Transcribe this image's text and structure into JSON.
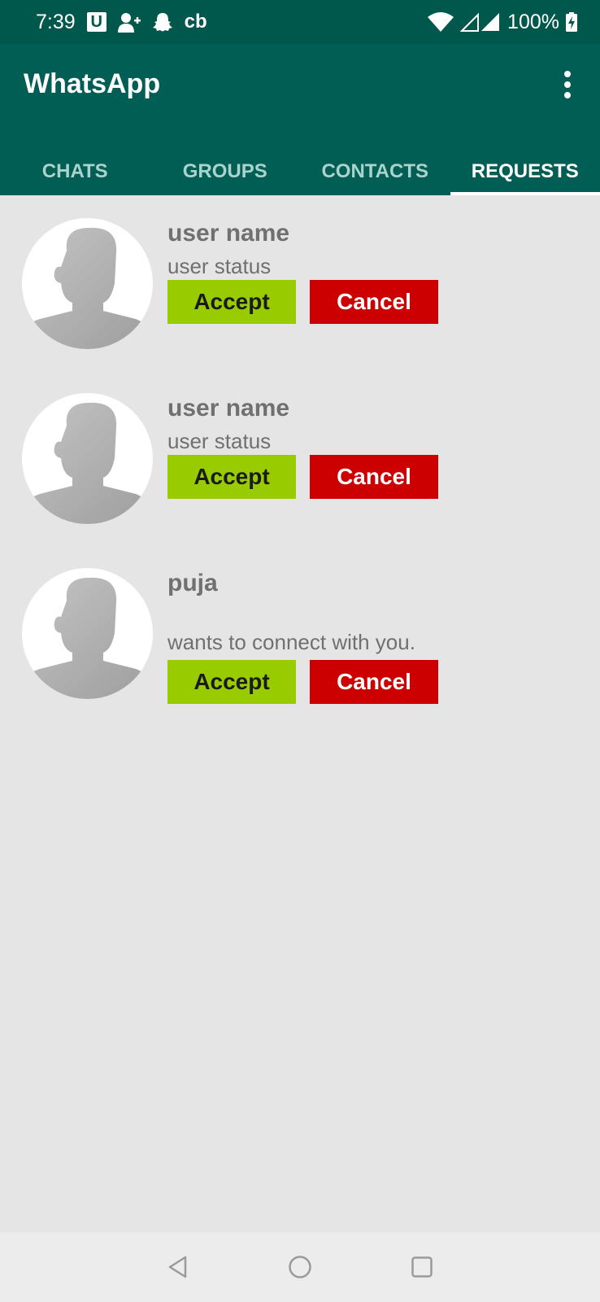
{
  "status_bar": {
    "time": "7:39",
    "u_icon_label": "U",
    "cb_label": "cb",
    "battery": "100%",
    "icons": [
      "u-icon",
      "add-user-icon",
      "snapchat-icon",
      "wifi-icon",
      "signal-icon",
      "battery-icon"
    ]
  },
  "app_bar": {
    "title": "WhatsApp",
    "menu_icon": "more-vert-icon"
  },
  "tabs": [
    {
      "label": "CHATS",
      "active": false
    },
    {
      "label": "GROUPS",
      "active": false
    },
    {
      "label": "CONTACTS",
      "active": false
    },
    {
      "label": "REQUESTS",
      "active": true
    }
  ],
  "requests": [
    {
      "name": "user name",
      "status": "user status",
      "accept_label": "Accept",
      "cancel_label": "Cancel"
    },
    {
      "name": "user name",
      "status": "user status",
      "accept_label": "Accept",
      "cancel_label": "Cancel"
    },
    {
      "name": "puja",
      "status": "wants to connect with you.",
      "accept_label": "Accept",
      "cancel_label": "Cancel"
    }
  ],
  "nav_bar": {
    "icons": [
      "back-icon",
      "home-icon",
      "recents-icon"
    ]
  },
  "colors": {
    "status_bar": "#00574b",
    "app_bar": "#005e54",
    "accept": "#99cc00",
    "cancel": "#cc0000",
    "background": "#e5e5e5"
  }
}
